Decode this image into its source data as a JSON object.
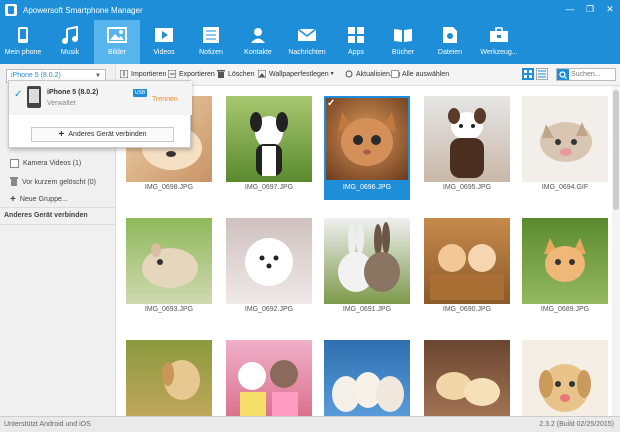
{
  "app": {
    "title": "Apowersoft Smartphone Manager"
  },
  "window_controls": {
    "minimize": "—",
    "restore": "❐",
    "close": "✕"
  },
  "toolbar": [
    {
      "label": "Mein phone",
      "icon": "phone-icon"
    },
    {
      "label": "Musik",
      "icon": "music-icon"
    },
    {
      "label": "Bilder",
      "icon": "image-icon",
      "active": true
    },
    {
      "label": "Videos",
      "icon": "video-icon"
    },
    {
      "label": "Notizen",
      "icon": "notes-icon"
    },
    {
      "label": "Kontakte",
      "icon": "contacts-icon"
    },
    {
      "label": "Nachrichten",
      "icon": "messages-icon"
    },
    {
      "label": "Apps",
      "icon": "apps-icon"
    },
    {
      "label": "Bücher",
      "icon": "books-icon"
    },
    {
      "label": "Dateien",
      "icon": "files-icon"
    },
    {
      "label": "Werkzeug...",
      "icon": "toolbox-icon"
    }
  ],
  "device_selector": {
    "value": "iPhone 5 (8.0.2)"
  },
  "device_popup": {
    "device_name": "iPhone 5 (8.0.2)",
    "device_status": "Verwaltet",
    "usb_badge": "USB",
    "disconnect": "Trennen",
    "connect_other": "Anderes Gerät verbinden"
  },
  "sidebar": {
    "items": [
      {
        "label": "Kamera Videos (1)"
      },
      {
        "label": "Vor kurzem gelöscht (0)"
      },
      {
        "label": "Neue Gruppe..."
      }
    ],
    "connect_other": "Anderes Gerät verbinden"
  },
  "actions": {
    "import": "Importieren",
    "export": "Exportieren",
    "delete": "Löschen",
    "wallpaper": "Wallpaperfestlegen",
    "refresh": "Aktualisierung",
    "select_all": "Alle auswählen"
  },
  "search": {
    "placeholder": "Suchen..."
  },
  "photos": [
    {
      "name": "IMG_0698.JPG",
      "bg": "#d9b48a"
    },
    {
      "name": "IMG_0697.JPG",
      "bg": "#6f9a3c"
    },
    {
      "name": "IMG_0696.JPG",
      "bg": "#b5733d",
      "selected": true
    },
    {
      "name": "IMG_0695.JPG",
      "bg": "#b98b6a"
    },
    {
      "name": "IMG_0694.GIF",
      "bg": "#e8e0d8"
    },
    {
      "name": "IMG_0693.JPG",
      "bg": "#9fb86f"
    },
    {
      "name": "IMG_0692.JPG",
      "bg": "#d8c7c2"
    },
    {
      "name": "IMG_0691.JPG",
      "bg": "#7c9a4a"
    },
    {
      "name": "IMG_0690.JPG",
      "bg": "#b9783c"
    },
    {
      "name": "IMG_0689.JPG",
      "bg": "#6c9b3e"
    },
    {
      "name": "",
      "bg": "#c79b52"
    },
    {
      "name": "",
      "bg": "#e06b8a"
    },
    {
      "name": "",
      "bg": "#3f83c4"
    },
    {
      "name": "",
      "bg": "#8a5d3c"
    },
    {
      "name": "",
      "bg": "#e9dcc6"
    }
  ],
  "status": {
    "left": "Unterstützt Android und iOS",
    "right": "2.3.2 (Build 02/25/2015)"
  },
  "colors": {
    "accent": "#1f8ed8",
    "orange": "#f08c2a"
  }
}
